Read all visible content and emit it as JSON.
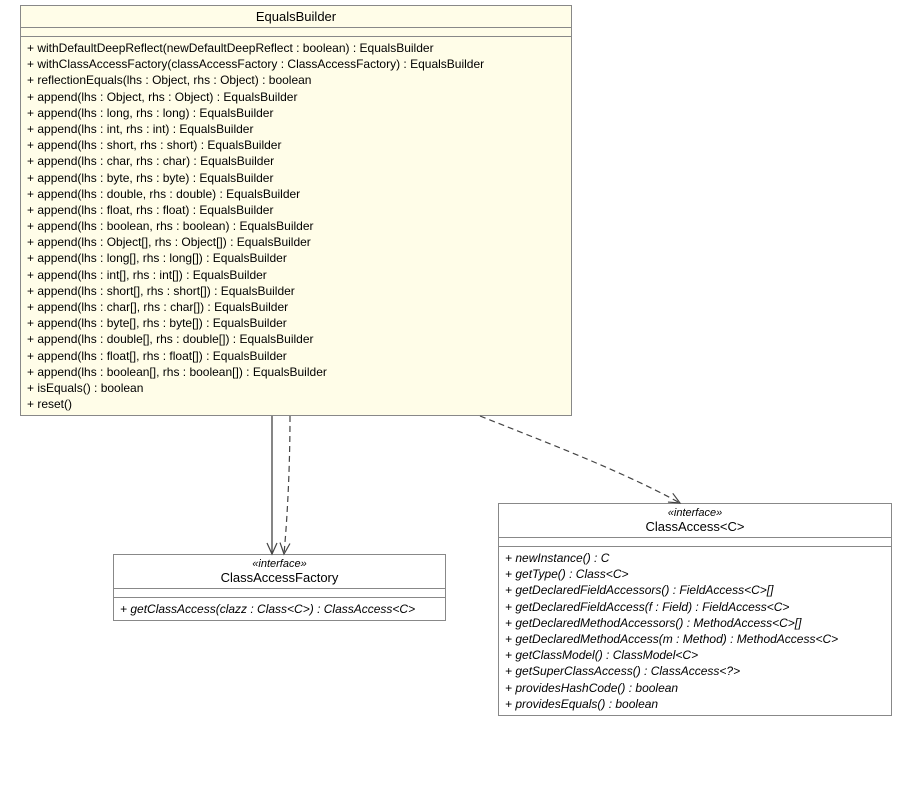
{
  "classes": {
    "equalsBuilder": {
      "name": "EqualsBuilder",
      "methods": [
        "+ withDefaultDeepReflect(newDefaultDeepReflect : boolean) : EqualsBuilder",
        "+ withClassAccessFactory(classAccessFactory : ClassAccessFactory) : EqualsBuilder",
        "+ reflectionEquals(lhs : Object, rhs : Object) : boolean",
        "+ append(lhs : Object, rhs : Object) : EqualsBuilder",
        "+ append(lhs : long, rhs : long) : EqualsBuilder",
        "+ append(lhs : int, rhs : int) : EqualsBuilder",
        "+ append(lhs : short, rhs : short) : EqualsBuilder",
        "+ append(lhs : char, rhs : char) : EqualsBuilder",
        "+ append(lhs : byte, rhs : byte) : EqualsBuilder",
        "+ append(lhs : double, rhs : double) : EqualsBuilder",
        "+ append(lhs : float, rhs : float) : EqualsBuilder",
        "+ append(lhs : boolean, rhs : boolean) : EqualsBuilder",
        "+ append(lhs : Object[], rhs : Object[]) : EqualsBuilder",
        "+ append(lhs : long[], rhs : long[]) : EqualsBuilder",
        "+ append(lhs : int[], rhs : int[]) : EqualsBuilder",
        "+ append(lhs : short[], rhs : short[]) : EqualsBuilder",
        "+ append(lhs : char[], rhs : char[]) : EqualsBuilder",
        "+ append(lhs : byte[], rhs : byte[]) : EqualsBuilder",
        "+ append(lhs : double[], rhs : double[]) : EqualsBuilder",
        "+ append(lhs : float[], rhs : float[]) : EqualsBuilder",
        "+ append(lhs : boolean[], rhs : boolean[]) : EqualsBuilder",
        "+ isEquals() : boolean",
        "+ reset()"
      ]
    },
    "classAccessFactory": {
      "stereotype": "«interface»",
      "name": "ClassAccessFactory",
      "methods": [
        "+ getClassAccess(clazz : Class<C>) : ClassAccess<C>"
      ],
      "abstractMethods": [
        0
      ]
    },
    "classAccess": {
      "stereotype": "«interface»",
      "name": "ClassAccess<C>",
      "methods": [
        "+ newInstance() : C",
        "+ getType() : Class<C>",
        "+ getDeclaredFieldAccessors() : FieldAccess<C>[]",
        "+ getDeclaredFieldAccess(f : Field) : FieldAccess<C>",
        "+ getDeclaredMethodAccessors() : MethodAccess<C>[]",
        "+ getDeclaredMethodAccess(m : Method) : MethodAccess<C>",
        "+ getClassModel() : ClassModel<C>",
        "+ getSuperClassAccess() : ClassAccess<?>",
        "+ providesHashCode() : boolean",
        "+ providesEquals() : boolean"
      ],
      "abstractMethods": [
        0,
        1,
        2,
        3,
        4,
        5,
        6,
        7,
        8,
        9
      ]
    }
  },
  "relations": [
    {
      "from": "equalsBuilder",
      "to": "classAccessFactory",
      "type": "association",
      "style": "solid"
    },
    {
      "from": "equalsBuilder",
      "to": "classAccessFactory",
      "type": "dependency",
      "style": "dashed"
    },
    {
      "from": "equalsBuilder",
      "to": "classAccess",
      "type": "dependency",
      "style": "dashed"
    }
  ]
}
